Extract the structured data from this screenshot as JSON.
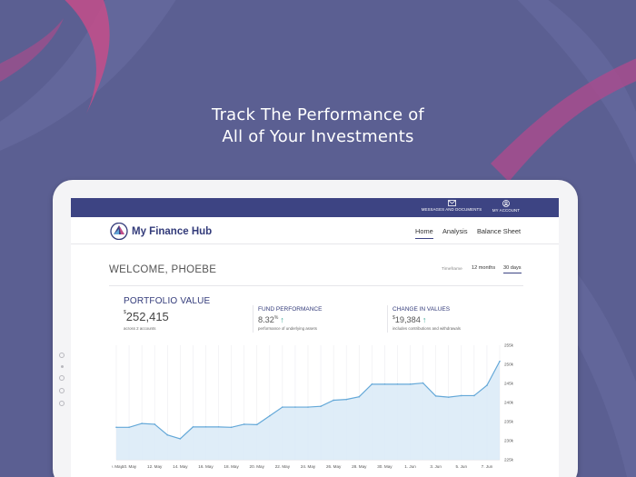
{
  "headline": {
    "line1": "Track The Performance of",
    "line2": "All of Your Investments"
  },
  "colors": {
    "background": "#5b5f92",
    "accent": "#3d4483",
    "chart_line": "#64a8d8",
    "chart_fill": "#dcebf7",
    "positive": "#3aa595"
  },
  "topbar": {
    "messages": {
      "label": "MESSAGES AND DOCUMENTS",
      "icon": "envelope-icon"
    },
    "account": {
      "label": "MY ACCOUNT",
      "icon": "user-circle-icon"
    }
  },
  "nav": {
    "brand": "My Finance Hub",
    "logo_icon": "sail-logo-icon",
    "links": [
      "Home",
      "Analysis",
      "Balance Sheet"
    ],
    "active": "Home"
  },
  "welcome": "WELCOME, PHOEBE",
  "timeframe": {
    "label": "Timeframe",
    "options": [
      "12 months",
      "30 days"
    ],
    "selected": "30 days"
  },
  "portfolio": {
    "title": "PORTFOLIO VALUE",
    "currency": "$",
    "value": "252,415",
    "sub": "across 2 accounts"
  },
  "fund": {
    "title": "FUND PERFORMANCE",
    "value": "8.32",
    "unit": "%",
    "sub": "performance of underlying assets",
    "trend": "up-arrow-icon"
  },
  "change": {
    "title": "CHANGE IN VALUES",
    "currency": "$",
    "value": "19,384",
    "sub": "includes contributions and withdrawals",
    "trend": "up-arrow-icon"
  },
  "chart_data": {
    "type": "area",
    "x": [
      "9. May",
      "10. May",
      "11. May",
      "12. May",
      "13. May",
      "14. May",
      "15. May",
      "16. May",
      "17. May",
      "18. May",
      "19. May",
      "20. May",
      "21. May",
      "22. May",
      "23. May",
      "24. May",
      "25. May",
      "26. May",
      "27. May",
      "28. May",
      "29. May",
      "30. May",
      "31. May",
      "1. Jun",
      "2. Jun",
      "3. Jun",
      "4. Jun",
      "5. Jun",
      "6. Jun",
      "7. Jun",
      "8. Jun"
    ],
    "x_tick_labels": [
      "9. May",
      "10. May",
      "12. May",
      "14. May",
      "16. May",
      "18. May",
      "20. May",
      "22. May",
      "24. May",
      "26. May",
      "28. May",
      "30. May",
      "1. Jun",
      "3. Jun",
      "5. Jun",
      "7. Jun"
    ],
    "values": [
      233.5,
      233.5,
      234.5,
      234.3,
      231.5,
      230.5,
      233.6,
      233.6,
      233.6,
      233.5,
      234.3,
      234.2,
      236.5,
      238.8,
      238.8,
      238.8,
      239.0,
      240.6,
      240.8,
      241.5,
      244.8,
      244.8,
      244.8,
      244.8,
      245.1,
      241.7,
      241.4,
      241.8,
      241.8,
      244.5,
      250.8
    ],
    "ylim": [
      225,
      255
    ],
    "y_ticks": [
      "225k",
      "230k",
      "235k",
      "240k",
      "245k",
      "250k",
      "255k"
    ],
    "grid": true
  }
}
